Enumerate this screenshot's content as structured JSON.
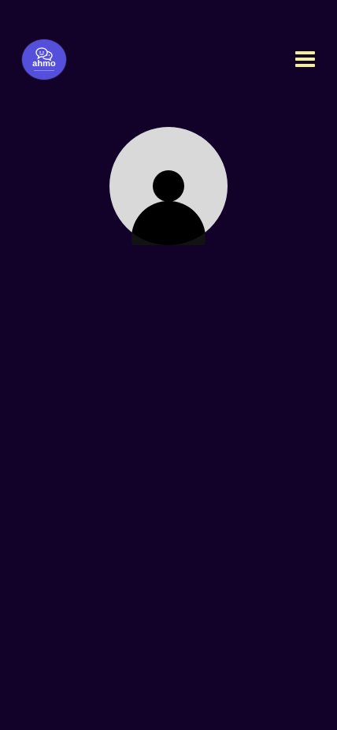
{
  "header": {
    "logo": {
      "text": "ahmo",
      "icon": "chat-bubbles-icon",
      "background": "#5550dc"
    },
    "menu": {
      "icon": "hamburger-menu-icon",
      "color": "#f3ef96"
    }
  },
  "profile": {
    "avatar": {
      "icon": "default-user-avatar-icon",
      "background": "#d9d9d9"
    }
  },
  "theme": {
    "background": "#12022a"
  }
}
